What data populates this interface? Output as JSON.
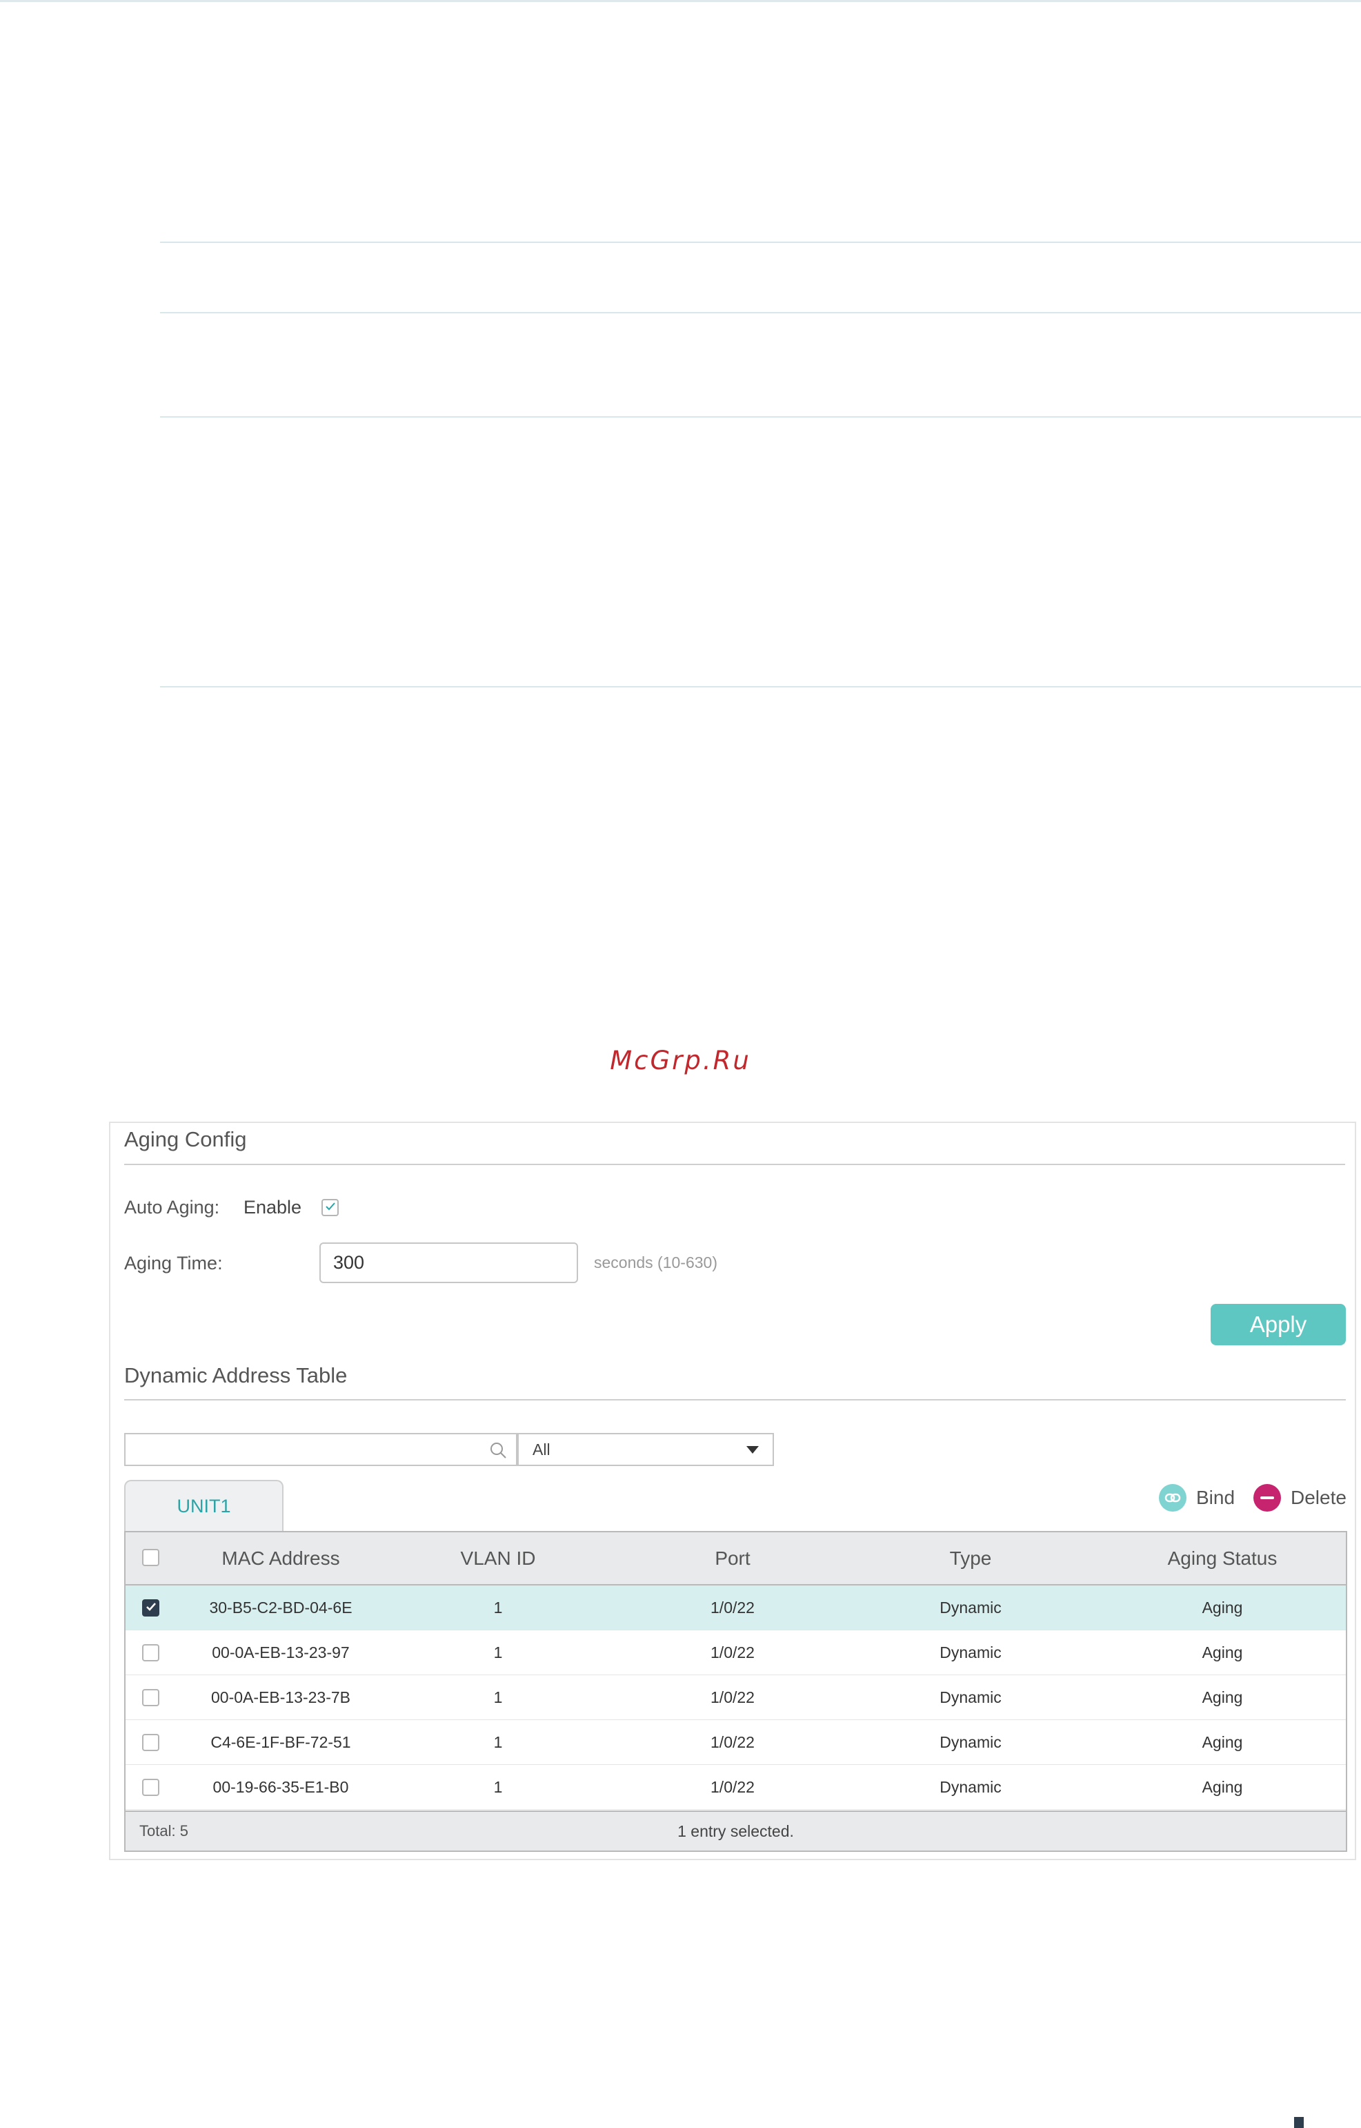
{
  "watermark": "McGrp.Ru",
  "aging_config": {
    "title": "Aging Config",
    "auto_aging_label": "Auto Aging:",
    "enable_label": "Enable",
    "enable_checked": true,
    "aging_time_label": "Aging Time:",
    "aging_time_value": "300",
    "aging_time_hint": "seconds (10-630)",
    "apply_label": "Apply"
  },
  "dynamic_table": {
    "title": "Dynamic Address Table",
    "search_value": "",
    "filter_selected": "All",
    "tab_label": "UNIT1",
    "bind_label": "Bind",
    "delete_label": "Delete",
    "columns": [
      "MAC Address",
      "VLAN ID",
      "Port",
      "Type",
      "Aging Status"
    ],
    "rows": [
      {
        "checked": true,
        "mac": "30-B5-C2-BD-04-6E",
        "vlan": "1",
        "port": "1/0/22",
        "type": "Dynamic",
        "aging": "Aging"
      },
      {
        "checked": false,
        "mac": "00-0A-EB-13-23-97",
        "vlan": "1",
        "port": "1/0/22",
        "type": "Dynamic",
        "aging": "Aging"
      },
      {
        "checked": false,
        "mac": "00-0A-EB-13-23-7B",
        "vlan": "1",
        "port": "1/0/22",
        "type": "Dynamic",
        "aging": "Aging"
      },
      {
        "checked": false,
        "mac": "C4-6E-1F-BF-72-51",
        "vlan": "1",
        "port": "1/0/22",
        "type": "Dynamic",
        "aging": "Aging"
      },
      {
        "checked": false,
        "mac": "00-19-66-35-E1-B0",
        "vlan": "1",
        "port": "1/0/22",
        "type": "Dynamic",
        "aging": "Aging"
      }
    ],
    "total": "Total: 5",
    "selection_info": "1 entry selected."
  },
  "colors": {
    "accent": "#5fc7c1",
    "delete": "#c6246f",
    "selected_row": "#d7efee",
    "watermark": "#c0282d"
  }
}
